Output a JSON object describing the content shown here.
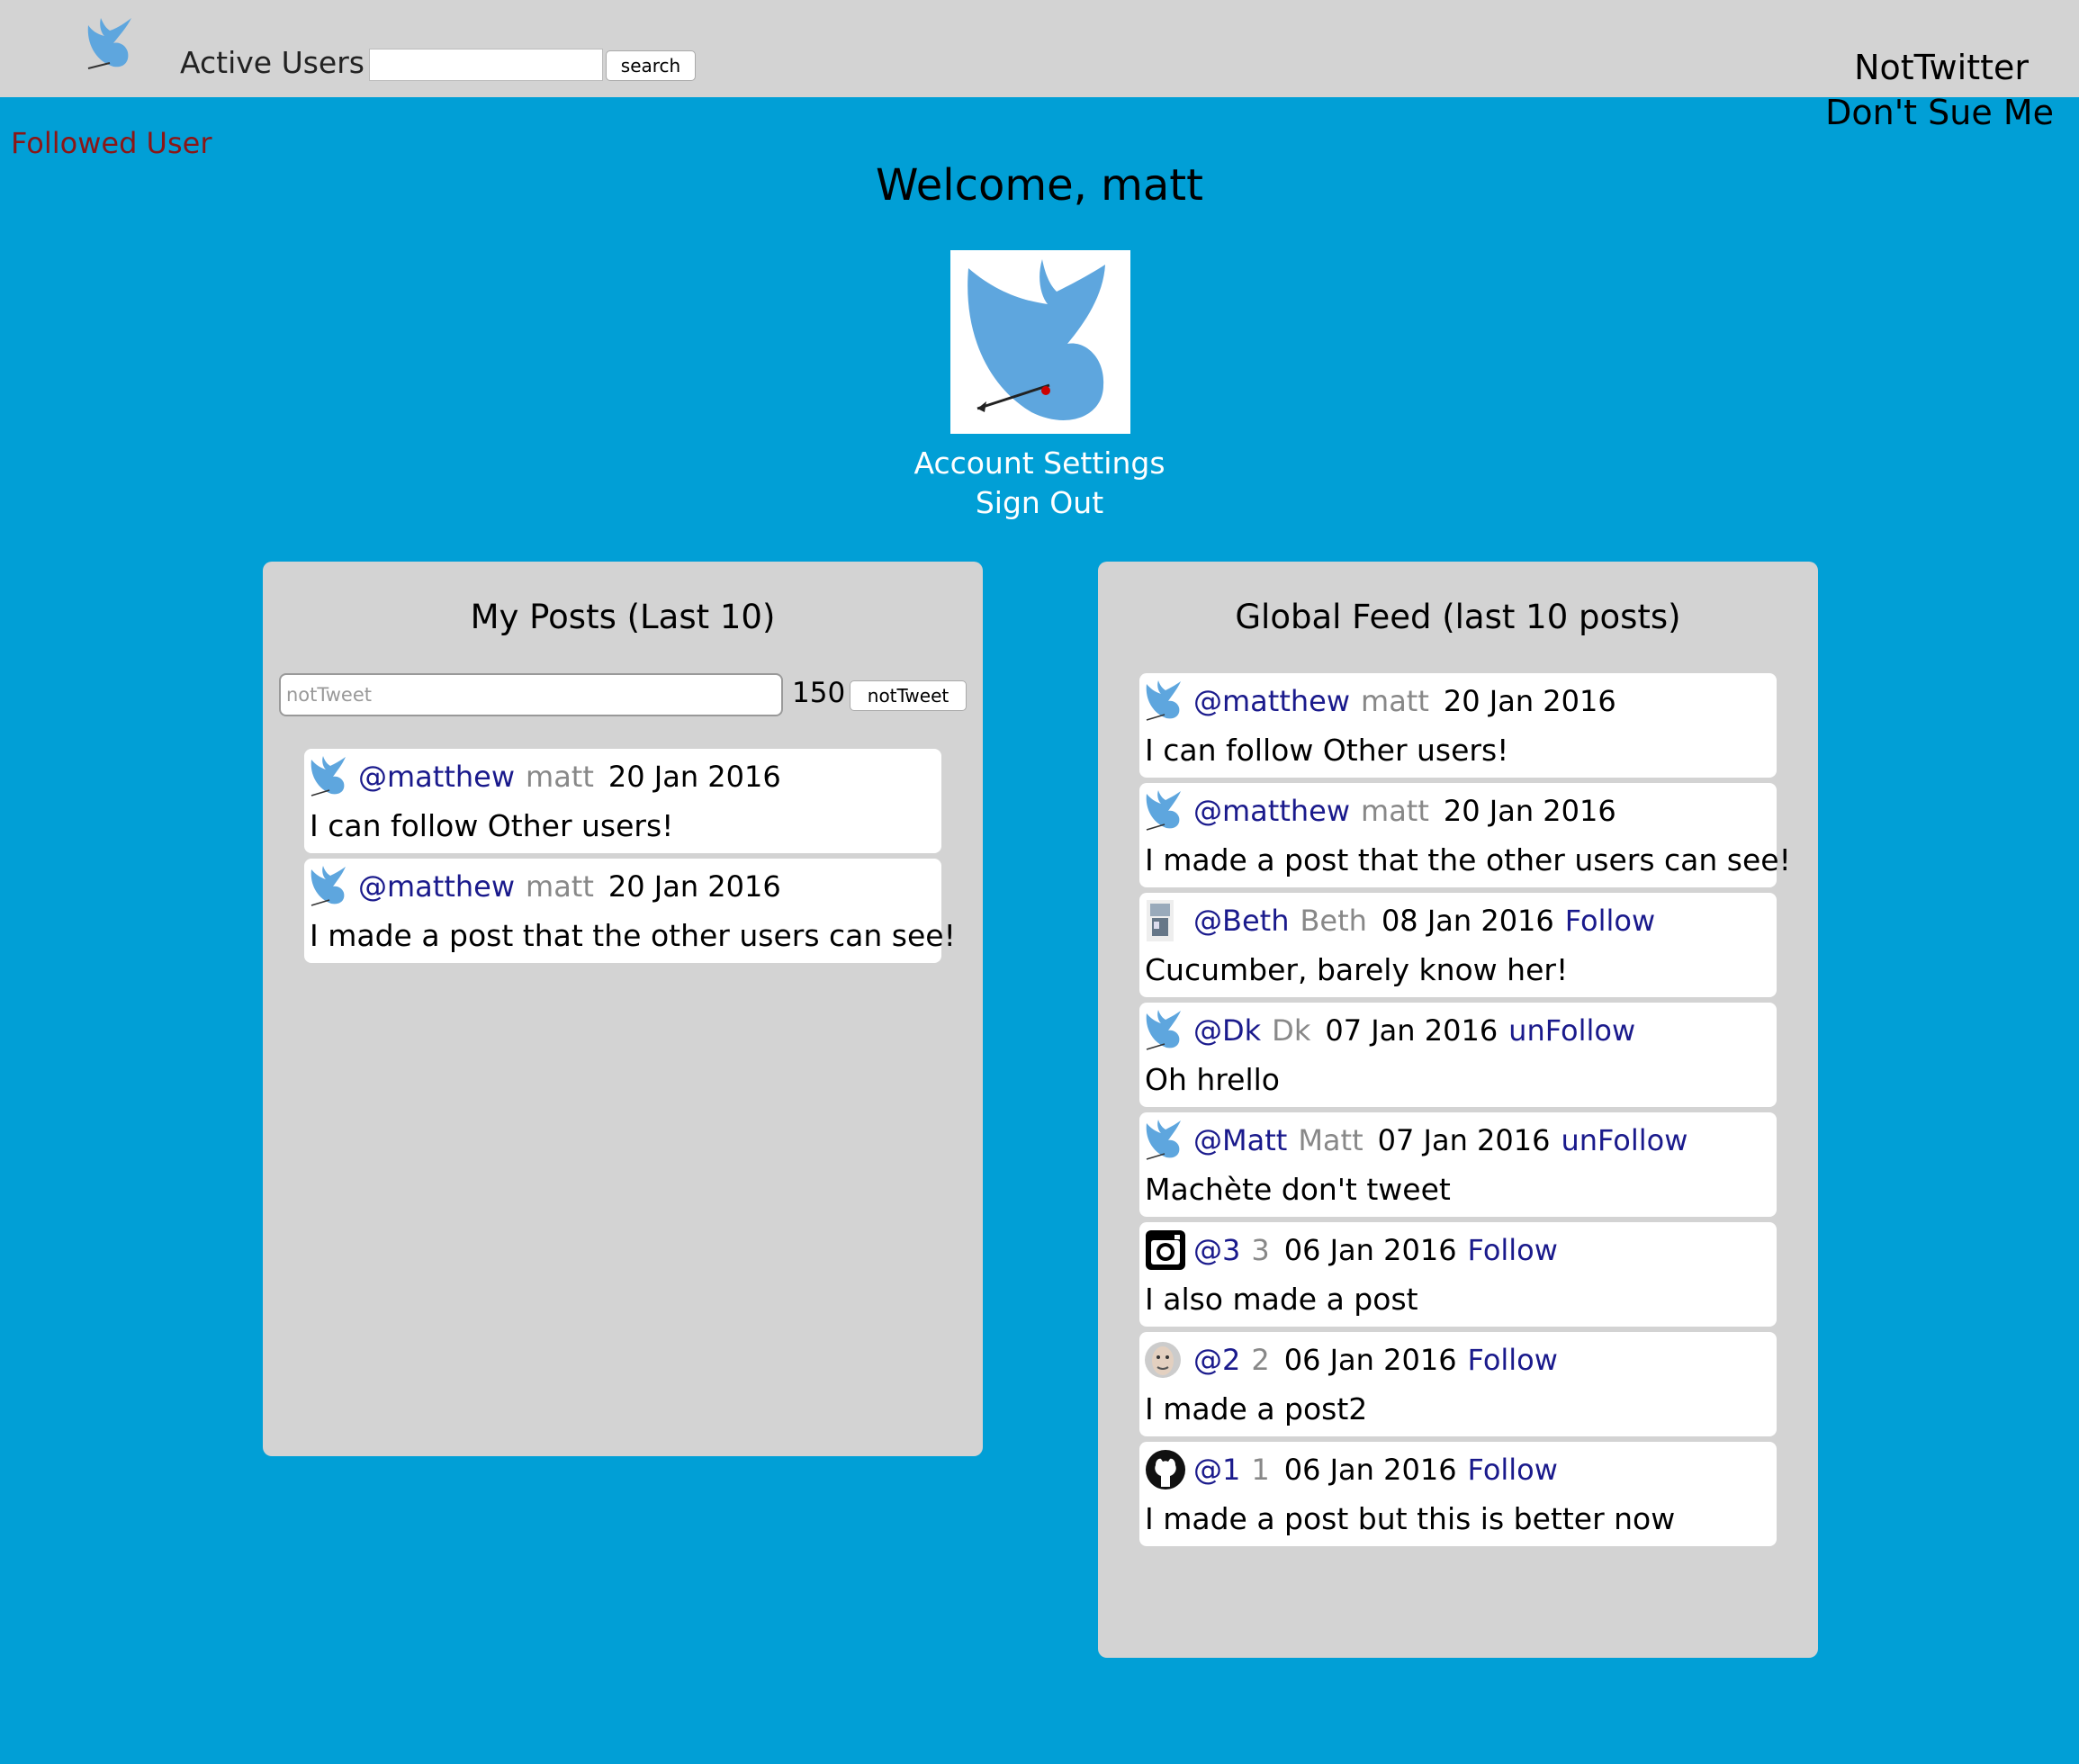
{
  "nav": {
    "active_users_label": "Active Users",
    "search_value": "",
    "search_button_label": "search",
    "brand_title": "NotTwitter",
    "brand_tagline": "Don't Sue Me"
  },
  "flash_message": "Followed User",
  "welcome": "Welcome, matt",
  "profile_links": {
    "account_settings": "Account Settings",
    "sign_out": "Sign Out"
  },
  "my_posts": {
    "title": "My Posts (Last 10)",
    "input_placeholder": "notTweet",
    "char_count": "150",
    "submit_label": "notTweet",
    "posts": [
      {
        "icon": "bird-icon",
        "handle": "@matthew",
        "name": "matt",
        "date": "20 Jan 2016",
        "follow": "",
        "text": "I can follow Other users!"
      },
      {
        "icon": "bird-icon",
        "handle": "@matthew",
        "name": "matt",
        "date": "20 Jan 2016",
        "follow": "",
        "text": "I made a post that the other users can see!"
      }
    ]
  },
  "global_feed": {
    "title": "Global Feed (last 10 posts)",
    "posts": [
      {
        "icon": "bird-icon",
        "handle": "@matthew",
        "name": "matt",
        "date": "20 Jan 2016",
        "follow": "",
        "text": "I can follow Other users!"
      },
      {
        "icon": "bird-icon",
        "handle": "@matthew",
        "name": "matt",
        "date": "20 Jan 2016",
        "follow": "",
        "text": "I made a post that the other users can see!"
      },
      {
        "icon": "photo-avatar-icon",
        "handle": "@Beth",
        "name": "Beth",
        "date": "08 Jan 2016",
        "follow": "Follow",
        "text": "Cucumber, barely know her!"
      },
      {
        "icon": "bird-icon",
        "handle": "@Dk",
        "name": "Dk",
        "date": "07 Jan 2016",
        "follow": "unFollow",
        "text": "Oh hrello"
      },
      {
        "icon": "bird-icon",
        "handle": "@Matt",
        "name": "Matt",
        "date": "07 Jan 2016",
        "follow": "unFollow",
        "text": "Machète don't tweet"
      },
      {
        "icon": "instagram-icon",
        "handle": "@3",
        "name": "3",
        "date": "06 Jan 2016",
        "follow": "Follow",
        "text": "I also made a post"
      },
      {
        "icon": "face-avatar-icon",
        "handle": "@2",
        "name": "2",
        "date": "06 Jan 2016",
        "follow": "Follow",
        "text": "I made a post2"
      },
      {
        "icon": "github-icon",
        "handle": "@1",
        "name": "1",
        "date": "06 Jan 2016",
        "follow": "Follow",
        "text": "I made a post but this is better now"
      }
    ]
  },
  "colors": {
    "page_background": "#019fd6",
    "panel_background": "#d3d3d3",
    "link_color": "#1a1a8c",
    "flash_color": "#8b1616",
    "bird_blue": "#5ea6de"
  }
}
